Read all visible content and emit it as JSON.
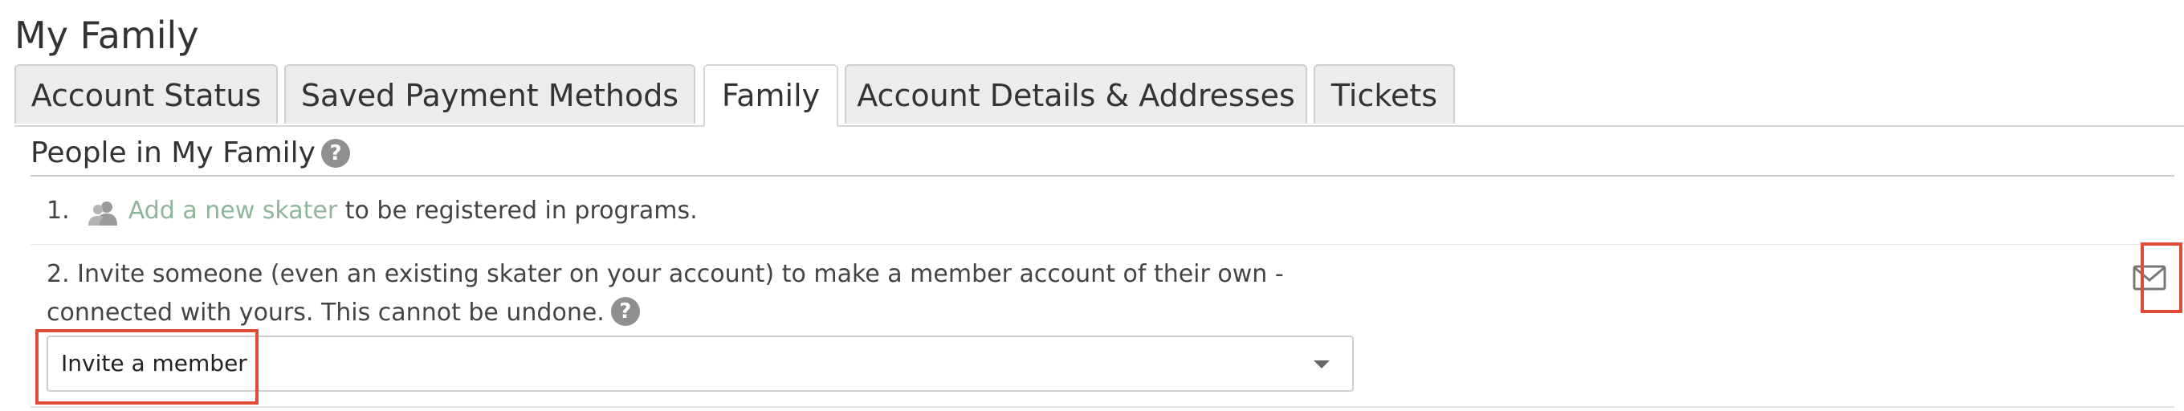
{
  "page": {
    "title": "My Family"
  },
  "tabs": [
    {
      "label": "Account Status"
    },
    {
      "label": "Saved Payment Methods"
    },
    {
      "label": "Family"
    },
    {
      "label": "Account Details & Addresses"
    },
    {
      "label": "Tickets"
    }
  ],
  "active_tab": "Family",
  "section": {
    "title": "People in My Family",
    "help_icon": "question-circle-icon"
  },
  "step1": {
    "number": "1.",
    "icon": "people-icon",
    "link_label": "Add a new skater",
    "rest": "to be registered in programs."
  },
  "step2": {
    "text": "2. Invite someone (even an existing skater on your account) to make a member account of their own - connected with yours. This cannot be undone.",
    "help_icon": "question-circle-icon"
  },
  "invite_select": {
    "value": "Invite a member"
  },
  "email_button": {
    "icon": "envelope-icon"
  },
  "colors": {
    "link": "#8fb59b",
    "highlight": "#e04c37",
    "help_icon_bg": "#8f8f8f"
  }
}
